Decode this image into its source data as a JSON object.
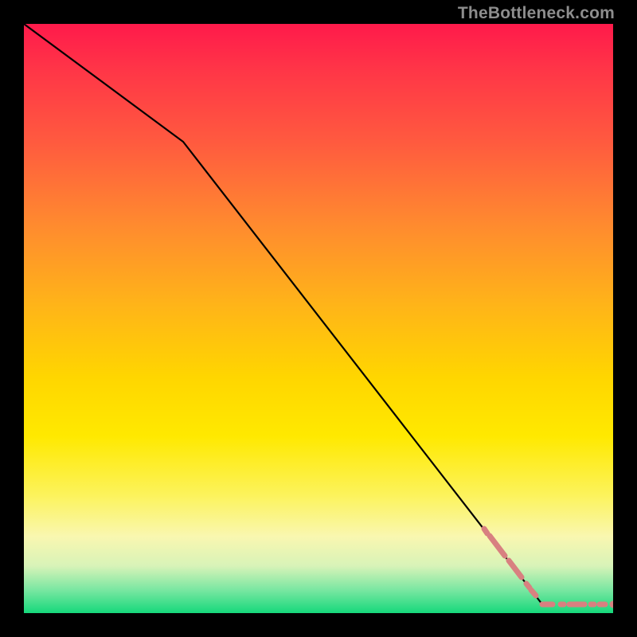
{
  "watermark": "TheBottleneck.com",
  "chart_data": {
    "type": "line",
    "title": "",
    "xlabel": "",
    "ylabel": "",
    "xlim": [
      0,
      100
    ],
    "ylim": [
      0,
      100
    ],
    "background_gradient": {
      "direction": "vertical",
      "stops": [
        {
          "pos": 0.0,
          "color": "#ff1a4b"
        },
        {
          "pos": 0.08,
          "color": "#ff3647"
        },
        {
          "pos": 0.2,
          "color": "#ff5a3f"
        },
        {
          "pos": 0.34,
          "color": "#ff8a2f"
        },
        {
          "pos": 0.48,
          "color": "#ffb518"
        },
        {
          "pos": 0.6,
          "color": "#ffd600"
        },
        {
          "pos": 0.7,
          "color": "#ffe900"
        },
        {
          "pos": 0.8,
          "color": "#fcf35c"
        },
        {
          "pos": 0.87,
          "color": "#f9f7b0"
        },
        {
          "pos": 0.92,
          "color": "#d8f3b8"
        },
        {
          "pos": 0.96,
          "color": "#7be7a2"
        },
        {
          "pos": 1.0,
          "color": "#16d87b"
        }
      ]
    },
    "series": [
      {
        "name": "black-curve",
        "color": "#000000",
        "stroke_width": 2.2,
        "markers": false,
        "x": [
          0,
          27,
          88
        ],
        "y": [
          100,
          80,
          1.5
        ]
      },
      {
        "name": "pink-dashed-segment",
        "color": "#d88080",
        "stroke_width": 7,
        "dash": true,
        "data": [
          {
            "x": 78.1,
            "y": 14.3,
            "len": 0.8
          },
          {
            "x": 79.0,
            "y": 13.2,
            "len": 4.0
          },
          {
            "x": 82.3,
            "y": 8.9,
            "len": 3.4
          },
          {
            "x": 85.3,
            "y": 5.1,
            "len": 0.8
          },
          {
            "x": 86.1,
            "y": 4.0,
            "len": 1.2
          }
        ]
      },
      {
        "name": "pink-dashed-baseline",
        "color": "#d88080",
        "stroke_width": 7,
        "dash": true,
        "data": [
          {
            "x": 88.0,
            "y": 1.5,
            "len": 1.8
          },
          {
            "x": 91.1,
            "y": 1.5,
            "len": 0.5
          },
          {
            "x": 92.6,
            "y": 1.5,
            "len": 2.6
          },
          {
            "x": 96.2,
            "y": 1.5,
            "len": 0.5
          },
          {
            "x": 97.7,
            "y": 1.5,
            "len": 1.0
          }
        ]
      },
      {
        "name": "pink-endpoint-marker",
        "color": "#d88080",
        "marker": "circle",
        "marker_size": 7,
        "x": [
          100
        ],
        "y": [
          1.5
        ]
      }
    ]
  }
}
